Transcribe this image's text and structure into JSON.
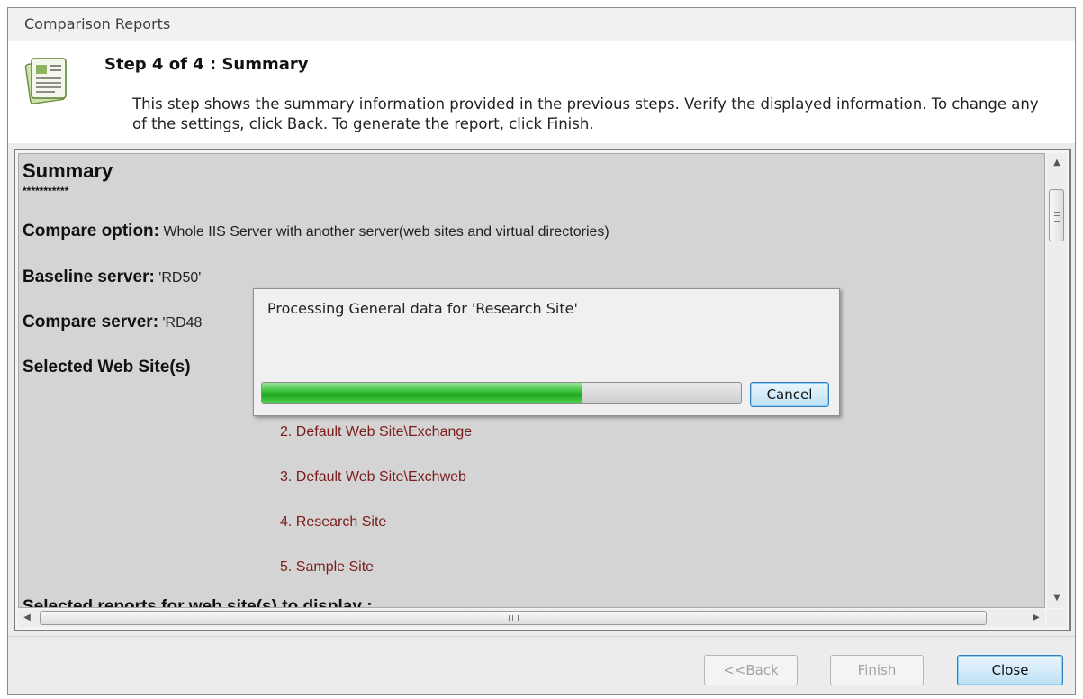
{
  "window": {
    "title": "Comparison Reports"
  },
  "header": {
    "icon": "report-document-icon",
    "step_title": "Step 4 of 4 : Summary",
    "step_description": "This step shows the summary information provided in the previous steps. Verify the displayed information. To change any of the settings, click Back. To generate the report, click Finish."
  },
  "summary": {
    "title": "Summary",
    "stars": "***********",
    "compare_option_label": "Compare option:",
    "compare_option_value": "Whole IIS Server with another server(web sites and virtual directories)",
    "baseline_label": "Baseline server:",
    "baseline_value": "'RD50'",
    "compare_server_label": "Compare server:",
    "compare_server_value": "'RD48",
    "selected_sites_label": "Selected Web Site(s)",
    "sites": [
      "2. Default Web Site\\Exchange",
      "3. Default Web Site\\Exchweb",
      "4. Research Site",
      "5. Sample Site"
    ],
    "reports_label": "Selected reports for web site(s) to display :"
  },
  "progress_dialog": {
    "message": "Processing General data for 'Research Site'",
    "progress_fraction": 0.67,
    "cancel_label": "Cancel"
  },
  "footer": {
    "back_prefix": "<<",
    "back_accel": "B",
    "back_rest": "ack",
    "finish_accel": "F",
    "finish_rest": "inish",
    "close_accel": "C",
    "close_rest": "lose"
  },
  "colors": {
    "site_text": "#7a1c1c",
    "progress_green": "#2fb52f"
  }
}
